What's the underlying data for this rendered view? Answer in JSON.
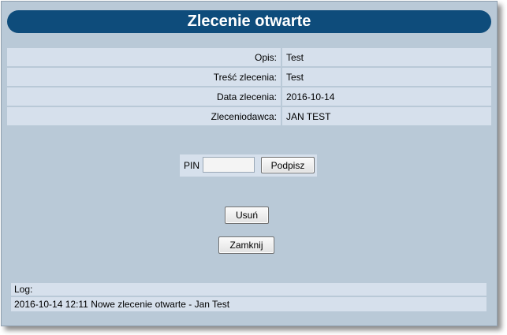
{
  "window": {
    "title": "Zlecenie otwarte"
  },
  "details": [
    {
      "label": "Opis:",
      "value": "Test"
    },
    {
      "label": "Treść zlecenia:",
      "value": "Test"
    },
    {
      "label": "Data zlecenia:",
      "value": "2016-10-14"
    },
    {
      "label": "Zleceniodawca:",
      "value": "JAN TEST"
    }
  ],
  "pin": {
    "label": "PIN",
    "value": "",
    "sign_button": "Podpisz"
  },
  "actions": {
    "delete_button": "Usuń",
    "close_button": "Zamknij"
  },
  "log": {
    "header": "Log:",
    "entries": [
      "2016-10-14 12:11 Nowe zlecenie otwarte - Jan Test"
    ]
  },
  "colors": {
    "title_bar": "#0e4c7b",
    "background": "#b9c9d7",
    "row_background": "#d6e0ec"
  }
}
